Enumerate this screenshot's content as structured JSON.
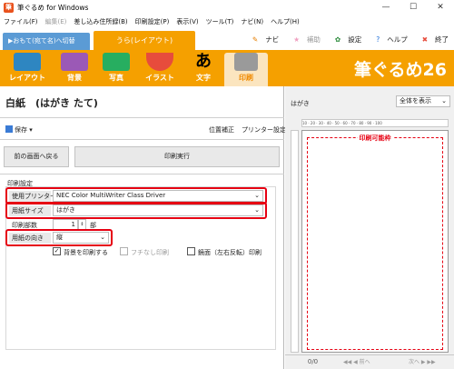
{
  "window": {
    "title": "筆ぐるめ for Windows",
    "app_icon_glyph": "筆",
    "controls": {
      "minimize": "—",
      "maximize": "☐",
      "close": "✕"
    }
  },
  "menu": {
    "items": [
      {
        "label": "ファイル(F)",
        "enabled": true
      },
      {
        "label": "編集(E)",
        "enabled": false
      },
      {
        "label": "差し込み住所録(B)",
        "enabled": true
      },
      {
        "label": "印刷設定(P)",
        "enabled": true
      },
      {
        "label": "表示(V)",
        "enabled": true
      },
      {
        "label": "ツール(T)",
        "enabled": true
      },
      {
        "label": "ナビ(N)",
        "enabled": true
      },
      {
        "label": "ヘルプ(H)",
        "enabled": true
      }
    ]
  },
  "side_tabs": {
    "omote": "▶おもて(宛て名)へ切替",
    "ura": "うら(レイアウト)"
  },
  "top_links": {
    "navi": "ナビ",
    "hojo": "補助",
    "settei": "設定",
    "help": "ヘルプ",
    "shuryo": "終了"
  },
  "toolbar": {
    "items": [
      {
        "label": "レイアウト",
        "color": "#2e86c1"
      },
      {
        "label": "背景",
        "color": "#9b59b6"
      },
      {
        "label": "写真",
        "color": "#27ae60"
      },
      {
        "label": "イラスト",
        "color": "#e74c3c"
      },
      {
        "label": "文字",
        "color": "#333333"
      },
      {
        "label": "印刷",
        "color": "#888888",
        "active": true
      }
    ],
    "moji_glyph": "あ",
    "brand": "筆ぐるめ26"
  },
  "left": {
    "doc_title": "白紙　(はがき たて)",
    "save_label": "保存",
    "position_adjust": "位置補正",
    "printer_settings": "プリンター設定",
    "back_button": "前の画面へ戻る",
    "print_button": "印刷実行",
    "section_label": "印刷設定",
    "printer_label": "使用プリンター",
    "printer_value": "NEC Color MultiWriter Class Driver",
    "paper_label": "用紙サイズ",
    "paper_value": "はがき",
    "copies_label": "印刷部数",
    "copies_value": "1",
    "copies_unit": "部",
    "orientation_label": "用紙の向き",
    "orientation_value": "縦",
    "print_background_label": "背景を印刷する",
    "print_background_checked": true,
    "borderless_label": "フチなし印刷",
    "borderless_checked": false,
    "mirror_label": "鏡面（左右反転）印刷",
    "mirror_checked": false
  },
  "right": {
    "title": "はがき",
    "zoom_value": "全体を表示",
    "ruler_ticks": "10 · 20 · 30 · 40 · 50 · 60 · 70 · 80 · 90 · 100",
    "printable_label": "印刷可能枠",
    "page_count": "0/0",
    "prev_label": "◀◀ ◀ 前へ",
    "next_label": "次へ ▶ ▶▶"
  },
  "colors": {
    "accent_orange": "#f5a000",
    "highlight_red": "#e60012",
    "tab_blue": "#5b9bd5"
  }
}
